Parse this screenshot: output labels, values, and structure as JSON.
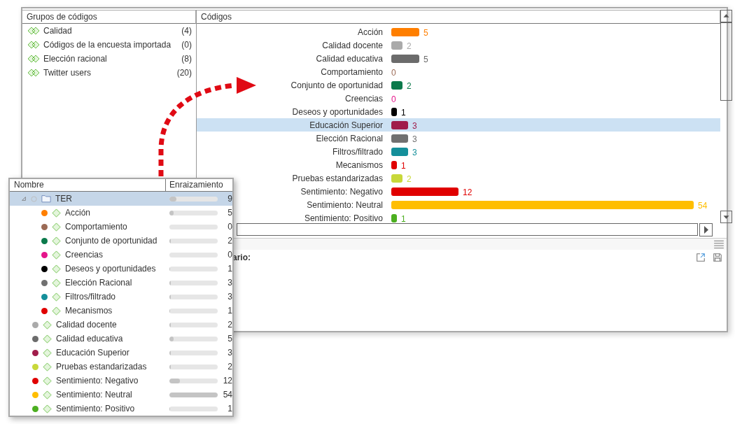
{
  "groups_panel": {
    "title": "Grupos de códigos",
    "items": [
      {
        "label": "Calidad",
        "count": "(4)"
      },
      {
        "label": "Códigos de la encuesta importada",
        "count": "(0)"
      },
      {
        "label": "Elección racional",
        "count": "(8)"
      },
      {
        "label": "Twitter users",
        "count": "(20)"
      }
    ]
  },
  "codes_panel": {
    "title": "Códigos",
    "rows": [
      {
        "color": "#ff7f00",
        "selected": false
      },
      {
        "color": "#aaaaaa",
        "selected": false
      },
      {
        "color": "#6b6b6b",
        "selected": false
      },
      {
        "color": "#9b6a55",
        "selected": false
      },
      {
        "color": "#0b7a4b",
        "selected": false
      },
      {
        "color": "#e5158a",
        "selected": false
      },
      {
        "color": "#000000",
        "selected": false
      },
      {
        "color": "#a01c4a",
        "selected": true
      },
      {
        "color": "#707070",
        "selected": false
      },
      {
        "color": "#148f9a",
        "selected": false
      },
      {
        "color": "#e00000",
        "selected": false
      },
      {
        "color": "#c8d83a",
        "selected": false
      },
      {
        "color": "#e00000",
        "selected": false
      },
      {
        "color": "#ffbe00",
        "selected": false
      },
      {
        "color": "#4caf20",
        "selected": false
      }
    ],
    "chart_data": {
      "type": "bar",
      "orientation": "horizontal",
      "categories": [
        "Acción",
        "Calidad docente",
        "Calidad educativa",
        "Comportamiento",
        "Conjunto de oportunidad",
        "Creencias",
        "Deseos y oportunidades",
        "Educación Superior",
        "Elección Racional",
        "Filtros/filtrado",
        "Mecanismos",
        "Pruebas estandarizadas",
        "Sentimiento: Negativo",
        "Sentimiento: Neutral",
        "Sentimiento: Positivo"
      ],
      "values": [
        5,
        2,
        5,
        0,
        2,
        0,
        1,
        3,
        3,
        3,
        1,
        2,
        12,
        54,
        1
      ],
      "data_labels": true
    }
  },
  "detail_panel": {
    "label": "ario:"
  },
  "overlay": {
    "columns": [
      "Nombre",
      "Enraizamiento"
    ],
    "tree": [
      {
        "kind": "folder",
        "label": "TER",
        "count": "9",
        "level": 0.15,
        "selected": true,
        "expanded": true,
        "children": [
          {
            "kind": "code",
            "label": "Acción",
            "count": "5",
            "color": "#ff7f00",
            "level": 0.09,
            "selected": false
          },
          {
            "kind": "code",
            "label": "Comportamiento",
            "count": "0",
            "color": "#9b6a55",
            "level": 0,
            "selected": false
          },
          {
            "kind": "code",
            "label": "Conjunto de oportunidad",
            "count": "2",
            "color": "#0b7a4b",
            "level": 0.03,
            "selected": false
          },
          {
            "kind": "code",
            "label": "Creencias",
            "count": "0",
            "color": "#e5158a",
            "level": 0,
            "selected": false
          },
          {
            "kind": "code",
            "label": "Deseos y oportunidades",
            "count": "1",
            "color": "#000000",
            "level": 0.02,
            "selected": false
          },
          {
            "kind": "code",
            "label": "Elección Racional",
            "count": "3",
            "color": "#707070",
            "level": 0.04,
            "selected": false
          },
          {
            "kind": "code",
            "label": "Filtros/filtrado",
            "count": "3",
            "color": "#148f9a",
            "level": 0.04,
            "selected": false
          },
          {
            "kind": "code",
            "label": "Mecanismos",
            "count": "1",
            "color": "#e00000",
            "level": 0.02,
            "selected": false
          }
        ]
      },
      {
        "kind": "code",
        "label": "Calidad docente",
        "count": "2",
        "color": "#aaaaaa",
        "level": 0.03,
        "selected": false
      },
      {
        "kind": "code",
        "label": "Calidad educativa",
        "count": "5",
        "color": "#6b6b6b",
        "level": 0.09,
        "selected": false
      },
      {
        "kind": "code",
        "label": "Educación Superior",
        "count": "3",
        "color": "#a01c4a",
        "level": 0.04,
        "selected": false
      },
      {
        "kind": "code",
        "label": "Pruebas estandarizadas",
        "count": "2",
        "color": "#c8d83a",
        "level": 0.03,
        "selected": false
      },
      {
        "kind": "code",
        "label": "Sentimiento: Negativo",
        "count": "12",
        "color": "#e00000",
        "level": 0.22,
        "selected": false
      },
      {
        "kind": "code",
        "label": "Sentimiento: Neutral",
        "count": "54",
        "color": "#ffbe00",
        "level": 1,
        "selected": false
      },
      {
        "kind": "code",
        "label": "Sentimiento: Positivo",
        "count": "1",
        "color": "#4caf20",
        "level": 0.02,
        "selected": false
      }
    ]
  }
}
